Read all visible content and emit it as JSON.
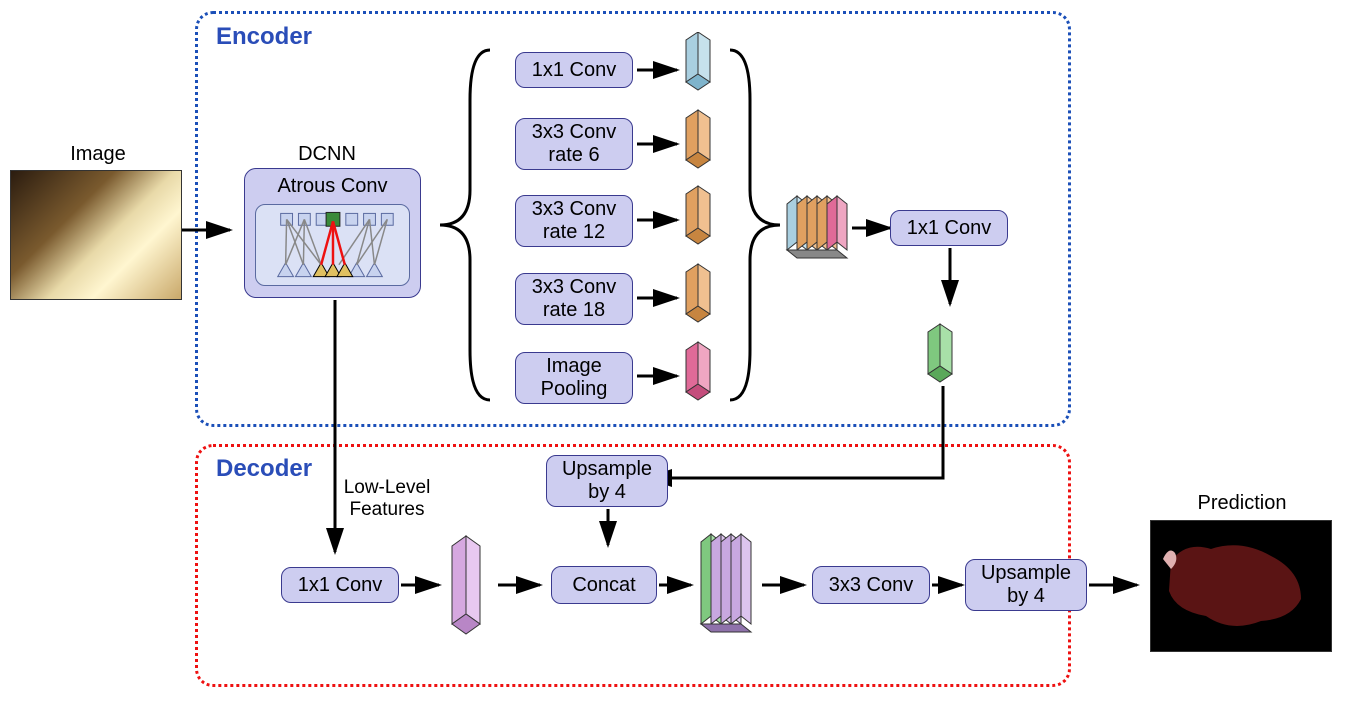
{
  "labels": {
    "image": "Image",
    "dcnn": "DCNN",
    "prediction": "Prediction",
    "low_level": "Low-Level\nFeatures"
  },
  "encoder": {
    "title": "Encoder",
    "atrous": "Atrous Conv",
    "branches": {
      "b1": "1x1 Conv",
      "b2": "3x3 Conv\nrate 6",
      "b3": "3x3 Conv\nrate 12",
      "b4": "3x3 Conv\nrate 18",
      "b5": "Image\nPooling"
    },
    "conv_after": "1x1 Conv"
  },
  "decoder": {
    "title": "Decoder",
    "upsample1": "Upsample\nby 4",
    "conv1": "1x1 Conv",
    "concat": "Concat",
    "conv3": "3x3 Conv",
    "upsample2": "Upsample\nby 4"
  }
}
